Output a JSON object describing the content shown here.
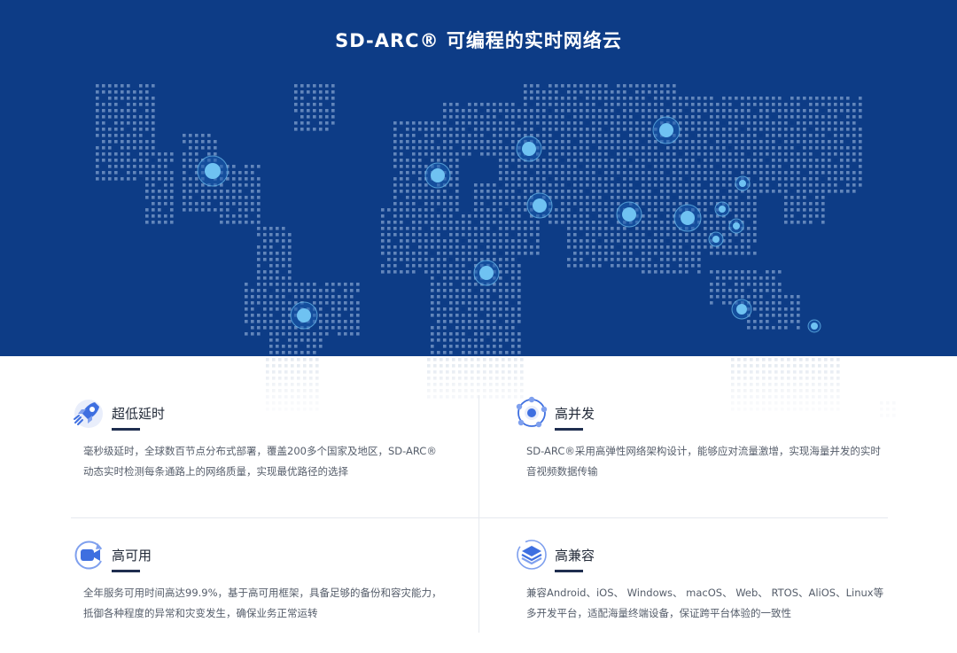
{
  "hero": {
    "title": "SD-ARC® 可编程的实时网络云"
  },
  "map": {
    "colors": {
      "background": "#0d3c86",
      "dots": "#7f9fcc",
      "node": "#6fc2f2",
      "dots_faded": "#dfe5ee"
    }
  },
  "features": [
    {
      "icon": "rocket-icon",
      "title": "超低延时",
      "desc": "毫秒级延时，全球数百节点分布式部署，覆盖200多个国家及地区，SD-ARC®动态实时检测每条通路上的网络质量，实现最优路径的选择"
    },
    {
      "icon": "network-nodes-icon",
      "title": "高并发",
      "desc": "SD-ARC®采用高弹性网络架构设计，能够应对流量激增，实现海量并发的实时音视频数据传输"
    },
    {
      "icon": "video-camera-icon",
      "title": "高可用",
      "desc": "全年服务可用时间高达99.9%，基于高可用框架，具备足够的备份和容灾能力，抵御各种程度的异常和灾变发生，确保业务正常运转"
    },
    {
      "icon": "layers-icon",
      "title": "高兼容",
      "desc": "兼容Android、iOS、 Windows、 macOS、 Web、 RTOS、AliOS、Linux等多开发平台，适配海量终端设备，保证跨平台体验的一致性"
    }
  ]
}
